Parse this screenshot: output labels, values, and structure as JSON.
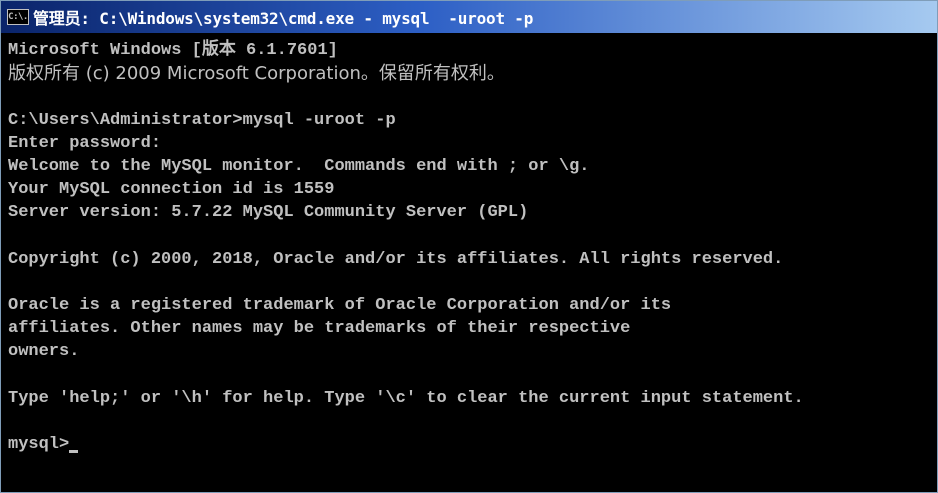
{
  "window": {
    "icon_label": "C:\\.",
    "title": "管理员: C:\\Windows\\system32\\cmd.exe - mysql  -uroot -p"
  },
  "console": {
    "lines": [
      "Microsoft Windows [版本 6.1.7601]",
      "版权所有 (c) 2009 Microsoft Corporation。保留所有权利。",
      "",
      "C:\\Users\\Administrator>mysql -uroot -p",
      "Enter password:",
      "Welcome to the MySQL monitor.  Commands end with ; or \\g.",
      "Your MySQL connection id is 1559",
      "Server version: 5.7.22 MySQL Community Server (GPL)",
      "",
      "Copyright (c) 2000, 2018, Oracle and/or its affiliates. All rights reserved.",
      "",
      "Oracle is a registered trademark of Oracle Corporation and/or its",
      "affiliates. Other names may be trademarks of their respective",
      "owners.",
      "",
      "Type 'help;' or '\\h' for help. Type '\\c' to clear the current input statement.",
      ""
    ],
    "prompt": "mysql>"
  },
  "colors": {
    "console_bg": "#000000",
    "console_fg": "#c0c0c0",
    "title_start": "#0a246a",
    "title_end": "#a6caf0"
  }
}
